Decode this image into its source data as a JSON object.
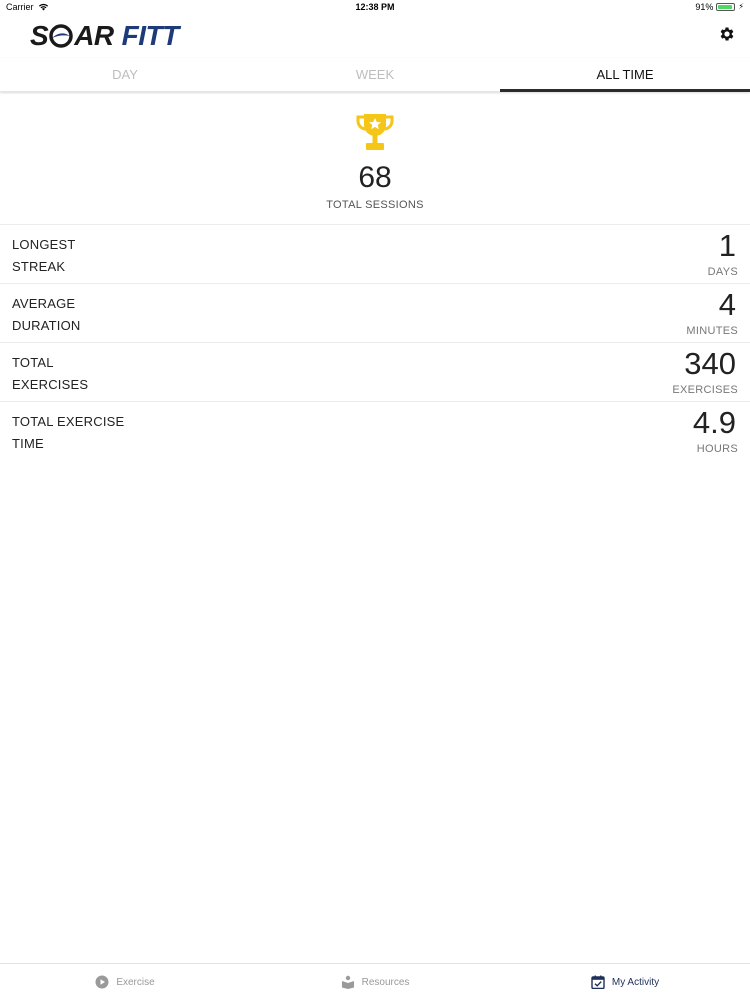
{
  "status_bar": {
    "carrier": "Carrier",
    "time": "12:38 PM",
    "battery": "91%",
    "battery_level": 0.91
  },
  "app": {
    "logo_left": "S",
    "logo_mid": "AR",
    "logo_right": "FITT",
    "settings_icon": "gear-icon"
  },
  "tabs": [
    {
      "label": "DAY",
      "active": false
    },
    {
      "label": "WEEK",
      "active": false
    },
    {
      "label": "ALL TIME",
      "active": true
    }
  ],
  "summary": {
    "icon": "trophy-icon",
    "total": "68",
    "label": "TOTAL SESSIONS"
  },
  "stats": [
    {
      "line1": "LONGEST",
      "line2": "STREAK",
      "value": "1",
      "unit": "DAYS"
    },
    {
      "line1": "AVERAGE",
      "line2": "DURATION",
      "value": "4",
      "unit": "MINUTES"
    },
    {
      "line1": "TOTAL",
      "line2": "EXERCISES",
      "value": "340",
      "unit": "EXERCISES"
    },
    {
      "line1": "TOTAL EXERCISE",
      "line2": "TIME",
      "value": "4.9",
      "unit": "HOURS"
    }
  ],
  "bottom_nav": [
    {
      "label": "Exercise",
      "icon": "play-circle-icon",
      "active": false
    },
    {
      "label": "Resources",
      "icon": "book-reader-icon",
      "active": false
    },
    {
      "label": "My Activity",
      "icon": "calendar-check-icon",
      "active": true
    }
  ],
  "colors": {
    "brand_navy": "#1e3a78",
    "trophy_gold": "#f5c518",
    "active_nav": "#1e2f5a"
  }
}
